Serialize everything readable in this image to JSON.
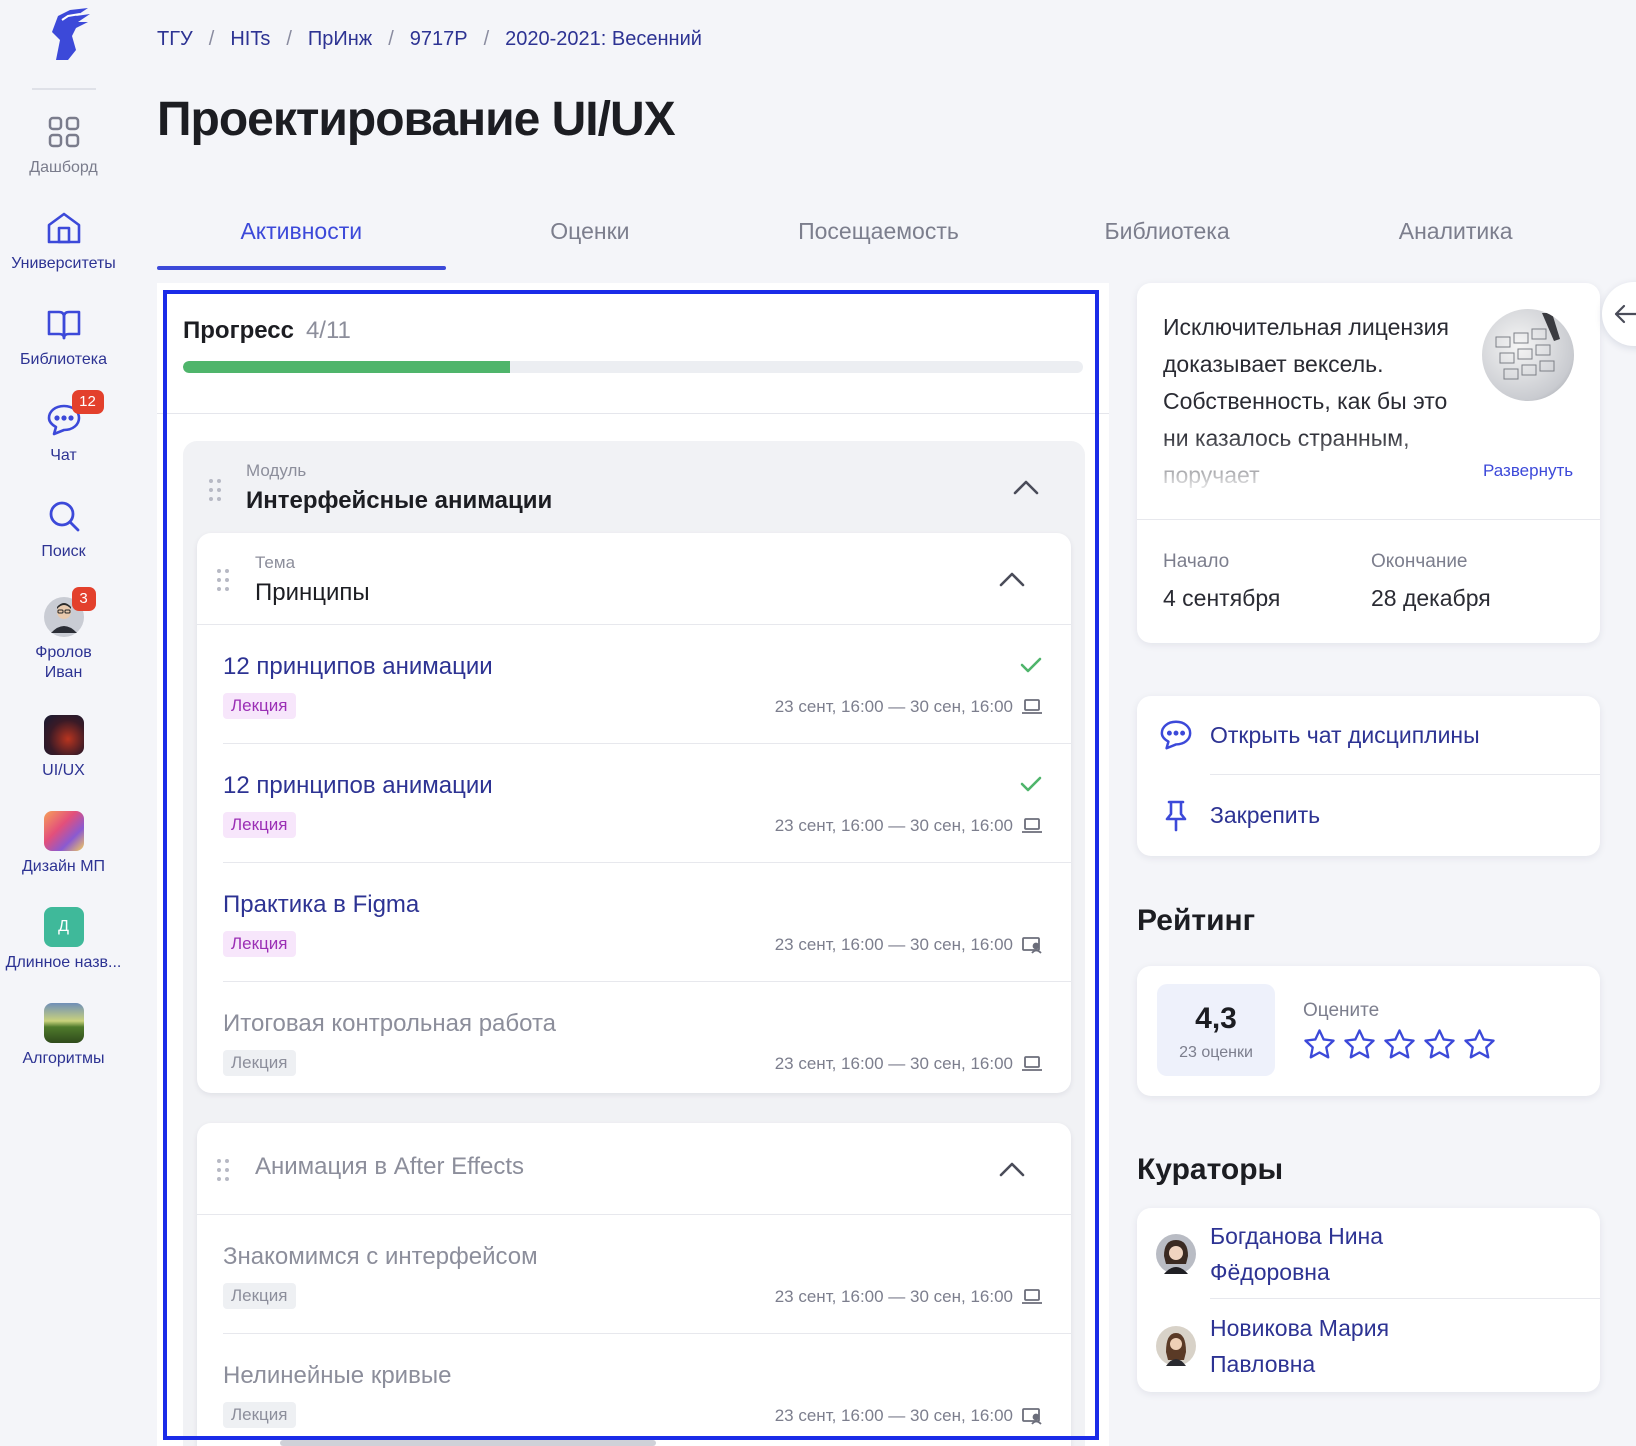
{
  "sidebar": {
    "items": [
      {
        "label": "Дашборд",
        "icon": "grid-icon"
      },
      {
        "label": "Университеты",
        "icon": "university-icon"
      },
      {
        "label": "Библиотека",
        "icon": "book-icon"
      },
      {
        "label": "Чат",
        "icon": "chat-icon",
        "badge": "12"
      },
      {
        "label": "Поиск",
        "icon": "search-icon"
      },
      {
        "label": "Фролов Иван",
        "icon": "avatar",
        "badge": "3"
      },
      {
        "label": "UI/UX",
        "icon": "course-thumb"
      },
      {
        "label": "Дизайн МП",
        "icon": "course-thumb"
      },
      {
        "label": "Длинное назв...",
        "icon": "course-initial",
        "initial": "Д"
      },
      {
        "label": "Алгоритмы",
        "icon": "course-thumb"
      }
    ]
  },
  "breadcrumbs": [
    "ТГУ",
    "HITs",
    "ПрИнж",
    "9717Р",
    "2020-2021: Весенний"
  ],
  "page_title": "Проектирование UI/UX",
  "tabs": [
    "Активности",
    "Оценки",
    "Посещаемость",
    "Библиотека",
    "Аналитика"
  ],
  "active_tab": "Активности",
  "progress": {
    "label": "Прогресс",
    "count": "4/11",
    "completed": 4,
    "total": 11
  },
  "module": {
    "caption": "Модуль",
    "name": "Интерфейсные анимации",
    "topics": [
      {
        "caption": "Тема",
        "name": "Принципы",
        "activities": [
          {
            "title": "12 принципов анимации",
            "tag": "Лекция",
            "dates": "23 сент, 16:00 — 30 сен, 16:00",
            "done": true,
            "mode": "online",
            "active": true
          },
          {
            "title": "12 принципов анимации",
            "tag": "Лекция",
            "dates": "23 сент, 16:00 — 30 сен, 16:00",
            "done": true,
            "mode": "online",
            "active": true
          },
          {
            "title": "Практика в Figma",
            "tag": "Лекция",
            "dates": "23 сент, 16:00 — 30 сен, 16:00",
            "done": false,
            "mode": "presentation",
            "active": true
          },
          {
            "title": "Итоговая контрольная работа",
            "tag": "Лекция",
            "dates": "23 сент, 16:00 — 30 сен, 16:00",
            "done": false,
            "mode": "online",
            "active": false
          }
        ]
      },
      {
        "name": "Анимация в After Effects",
        "activities": [
          {
            "title": "Знакомимся с интерфейсом",
            "tag": "Лекция",
            "dates": "23 сент, 16:00 — 30 сен, 16:00",
            "mode": "online",
            "active": false
          },
          {
            "title": "Нелинейные кривые",
            "tag": "Лекция",
            "dates": "23 сент, 16:00 — 30 сен, 16:00",
            "mode": "presentation",
            "active": false
          }
        ]
      }
    ]
  },
  "info": {
    "description": "Исключительная лицензия доказывает вексель. Собственность, как бы это ни казалось странным, поручает",
    "expand_label": "Развернуть",
    "start_caption": "Начало",
    "start_value": "4 сентября",
    "end_caption": "Окончание",
    "end_value": "28 декабря"
  },
  "actions": {
    "open_chat": "Открыть чат дисциплины",
    "pin": "Закрепить"
  },
  "rating": {
    "heading": "Рейтинг",
    "value": "4,3",
    "count": "23 оценки",
    "rate_label": "Оцените",
    "stars": 5
  },
  "curators": {
    "heading": "Кураторы",
    "list": [
      {
        "name": "Богданова Нина Фёдоровна"
      },
      {
        "name": "Новикова Мария Павловна"
      }
    ]
  },
  "colors": {
    "accent": "#3c49d9",
    "link": "#2d3393",
    "progress": "#4fb56b",
    "badge": "#e3402c",
    "selection": "#1a2be8"
  }
}
